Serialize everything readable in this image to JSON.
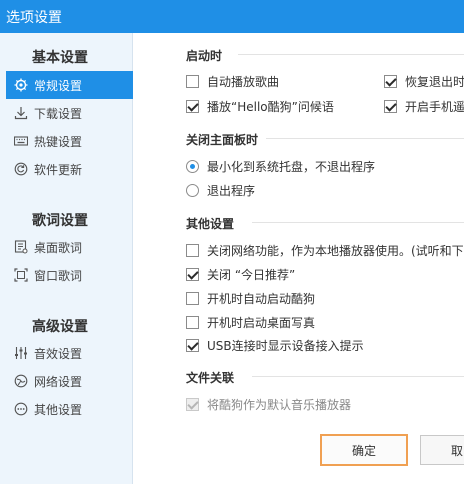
{
  "window": {
    "title": "选项设置"
  },
  "sidebar": {
    "groups": [
      {
        "title": "基本设置",
        "items": [
          {
            "label": "常规设置",
            "icon": "gear-icon",
            "active": true
          },
          {
            "label": "下载设置",
            "icon": "download-icon"
          },
          {
            "label": "热键设置",
            "icon": "keyboard-icon"
          },
          {
            "label": "软件更新",
            "icon": "update-icon"
          }
        ]
      },
      {
        "title": "歌词设置",
        "items": [
          {
            "label": "桌面歌词",
            "icon": "desktop-lyrics-icon"
          },
          {
            "label": "窗口歌词",
            "icon": "window-lyrics-icon"
          }
        ]
      },
      {
        "title": "高级设置",
        "items": [
          {
            "label": "音效设置",
            "icon": "equalizer-icon"
          },
          {
            "label": "网络设置",
            "icon": "network-icon"
          },
          {
            "label": "其他设置",
            "icon": "more-icon"
          }
        ]
      }
    ],
    "accent": "#1f8fe6"
  },
  "sections": {
    "startup": {
      "title": "启动时",
      "options": [
        {
          "label": "自动播放歌曲",
          "checked": false
        },
        {
          "label": "恢复退出时",
          "checked": true
        },
        {
          "label": "播放“Hello酷狗”问候语",
          "checked": true
        },
        {
          "label": "开启手机遥",
          "checked": true
        }
      ]
    },
    "close_panel": {
      "title": "关闭主面板时",
      "options": [
        {
          "label": "最小化到系统托盘，不退出程序",
          "selected": true
        },
        {
          "label": "退出程序",
          "selected": false
        }
      ]
    },
    "other": {
      "title": "其他设置",
      "options": [
        {
          "label": "关闭网络功能，作为本地播放器使用。(试听和下",
          "checked": false
        },
        {
          "label": "关闭 “今日推荐”",
          "checked": true
        },
        {
          "label": "开机时自动启动酷狗",
          "checked": false
        },
        {
          "label": "开机时启动桌面写真",
          "checked": false
        },
        {
          "label": "USB连接时显示设备接入提示",
          "checked": true
        }
      ]
    },
    "file_assoc": {
      "title": "文件关联",
      "options": [
        {
          "label": "将酷狗作为默认音乐播放器",
          "checked": true,
          "disabled": true
        }
      ]
    }
  },
  "buttons": {
    "ok": "确定",
    "cancel": "取"
  }
}
